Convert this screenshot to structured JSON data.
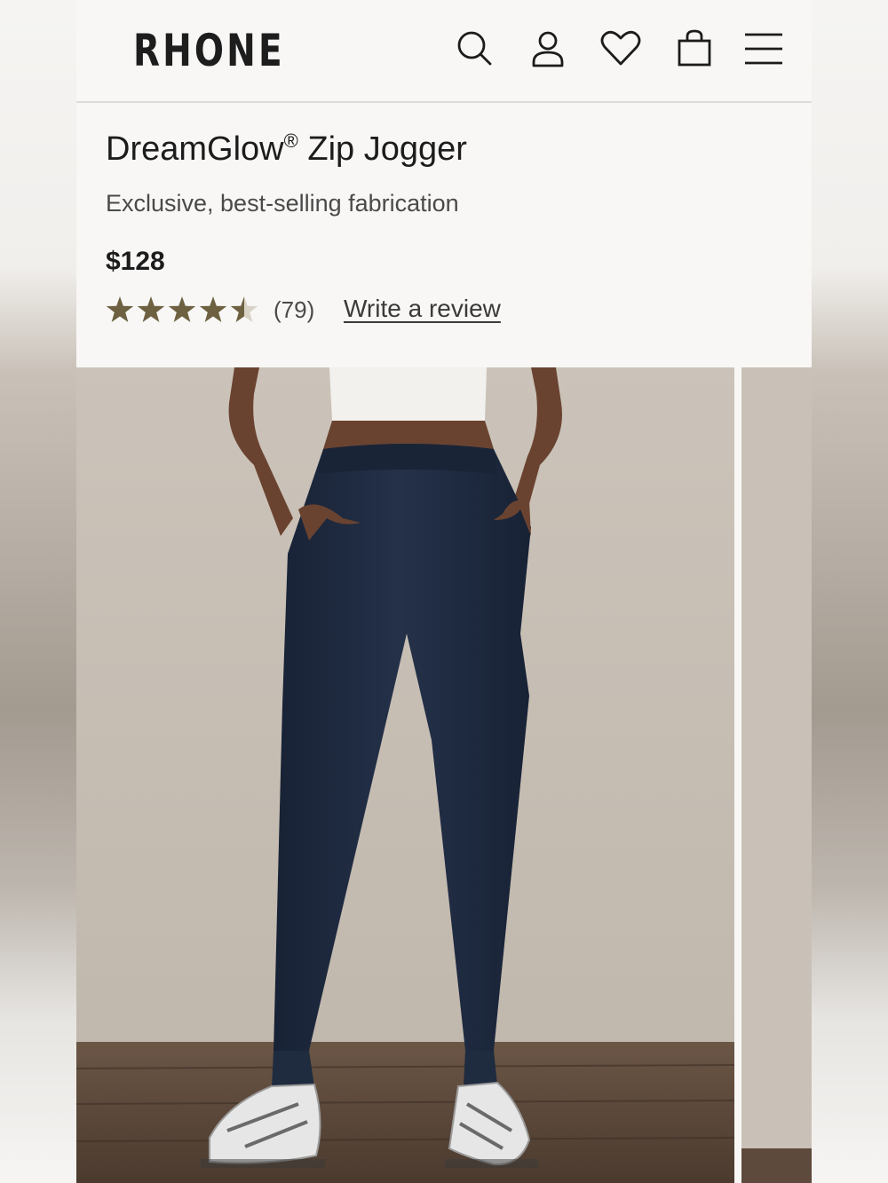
{
  "header": {
    "logo": "RHONE",
    "icons": [
      "search-icon",
      "account-icon",
      "wishlist-heart-icon",
      "shopping-bag-icon",
      "menu-icon"
    ]
  },
  "product": {
    "title": "DreamGlow",
    "title_mark": "®",
    "title_suffix": " Zip Jogger",
    "subtitle": "Exclusive, best-selling fabrication",
    "price": "$128",
    "rating": 4.5,
    "rating_max": 5,
    "review_count": "(79)",
    "write_review_label": "Write a review"
  },
  "colors": {
    "star": "#6e6142",
    "text_primary": "#1c1c1c",
    "pant_navy": "#1f2b3f"
  }
}
